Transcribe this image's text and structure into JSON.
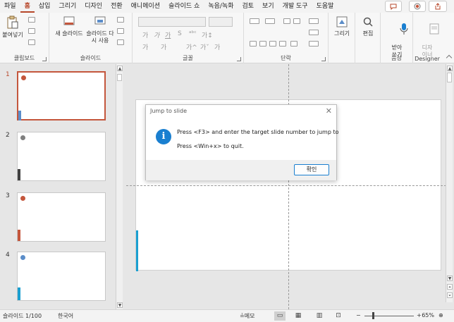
{
  "ribbon_tabs": [
    "파일",
    "홈",
    "삽입",
    "그리기",
    "디자인",
    "전환",
    "애니메이션",
    "슬라이드 쇼",
    "녹음/녹화",
    "검토",
    "보기",
    "개발 도구",
    "도움말"
  ],
  "active_tab": "홈",
  "ribbon": {
    "clipboard": {
      "paste_label": "붙여넣기",
      "group_label": "클립보드"
    },
    "slides": {
      "new_slide_label": "새 슬라이드",
      "reuse_slides_label": "슬라이드 다시 사용",
      "group_label": "슬라이드"
    },
    "font": {
      "font_name": "",
      "font_size": "",
      "bold": "가",
      "italic": "가",
      "underline": "가",
      "strikethrough": "S",
      "spacing": "ᵃᵇᶜ",
      "case": "가↕",
      "highlight": "가",
      "font_color": "가",
      "grow": "가^",
      "shrink": "가ˇ",
      "clear": "가",
      "group_label": "글꼴"
    },
    "paragraph": {
      "group_label": "단락"
    },
    "drawing": {
      "draw_label": "그리기",
      "group_label": ""
    },
    "editing": {
      "edit_label": "편집",
      "group_label": ""
    },
    "voice": {
      "dictate_label": "받아\n쓰기",
      "group_label": "음성"
    },
    "designer": {
      "ideas_label": "디자\n이너",
      "group_label": "Designer"
    }
  },
  "slides": [
    {
      "number": "1",
      "selected": true,
      "dot_color": "#c4563c",
      "bar_color": "#5b8dc9"
    },
    {
      "number": "2",
      "selected": false,
      "dot_color": "#7f7f7f",
      "bar_color": "#404040"
    },
    {
      "number": "3",
      "selected": false,
      "dot_color": "#c4563c",
      "bar_color": "#c4563c"
    },
    {
      "number": "4",
      "selected": false,
      "dot_color": "#5b8dc9",
      "bar_color": "#1a9fd0"
    }
  ],
  "dialog": {
    "title": "Jump to slide",
    "line1": "Press <F3> and enter the target slide number to jump to",
    "line2": "Press <Win+x> to quit.",
    "ok_label": "확인"
  },
  "status": {
    "slide_info": "슬라이드 1/100",
    "language": "한국어",
    "notes_label": "≟메모",
    "zoom": "65%"
  },
  "colors": {
    "accent": "#b7472a",
    "info_icon": "#1a7fd0",
    "slide_side_bar": "#1a9fd0"
  }
}
